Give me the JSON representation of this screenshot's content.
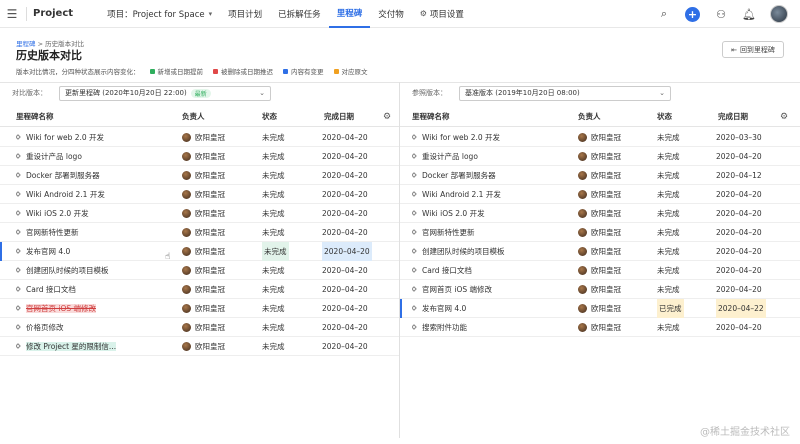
{
  "topbar": {
    "app_title": "Project",
    "project_label": "项目：Project for Space",
    "nav": [
      "项目计划",
      "已拆解任务",
      "里程碑",
      "交付物",
      "项目设置"
    ],
    "active_nav": 2
  },
  "header": {
    "breadcrumb_parent": "里程碑",
    "breadcrumb_sep": ">",
    "breadcrumb_current": "历史版本对比",
    "title": "历史版本对比",
    "back_button": "回到里程碑",
    "legend_intro": "版本对比情况，分四种状态展示内容变化：",
    "legend": [
      {
        "label": "新增或日期提前",
        "color": "#2fae5d"
      },
      {
        "label": "被删除或日期推迟",
        "color": "#e04848"
      },
      {
        "label": "内容有变更",
        "color": "#2f6fe6"
      },
      {
        "label": "对应原文",
        "color": "#f0a020"
      }
    ]
  },
  "left": {
    "compare_label": "对比版本：",
    "select_value": "更新里程碑 (2020年10月20日 22:00)",
    "select_tag": "最新",
    "columns": [
      "里程碑名称",
      "负责人",
      "状态",
      "完成日期"
    ],
    "rows": [
      {
        "name": "Wiki for web 2.0 开发",
        "owner": "欧阳皇冠",
        "status": "未完成",
        "date": "2020–04–20",
        "hl": ""
      },
      {
        "name": "重设计产品 logo",
        "owner": "欧阳皇冠",
        "status": "未完成",
        "date": "2020–04–20",
        "hl": ""
      },
      {
        "name": "Docker 部署到服务器",
        "owner": "欧阳皇冠",
        "status": "未完成",
        "date": "2020–04–20",
        "hl": ""
      },
      {
        "name": "Wiki Android 2.1 开发",
        "owner": "欧阳皇冠",
        "status": "未完成",
        "date": "2020–04–20",
        "hl": ""
      },
      {
        "name": "Wiki iOS 2.0 开发",
        "owner": "欧阳皇冠",
        "status": "未完成",
        "date": "2020–04–20",
        "hl": ""
      },
      {
        "name": "官网新特性更新",
        "owner": "欧阳皇冠",
        "status": "未完成",
        "date": "2020–04–20",
        "hl": ""
      },
      {
        "name": "发布官网 4.0",
        "owner": "欧阳皇冠",
        "status": "未完成",
        "date": "2020–04–20",
        "hl": "changed"
      },
      {
        "name": "创建团队时候的项目模板",
        "owner": "欧阳皇冠",
        "status": "未完成",
        "date": "2020–04–20",
        "hl": ""
      },
      {
        "name": "Card 接口文档",
        "owner": "欧阳皇冠",
        "status": "未完成",
        "date": "2020–04–20",
        "hl": ""
      },
      {
        "name": "官网首页 iOS 端修改",
        "owner": "欧阳皇冠",
        "status": "未完成",
        "date": "2020–04–20",
        "hl": "deleted"
      },
      {
        "name": "价格页修改",
        "owner": "欧阳皇冠",
        "status": "未完成",
        "date": "2020–04–20",
        "hl": ""
      },
      {
        "name": "修改 Project 星的限制信...",
        "owner": "欧阳皇冠",
        "status": "未完成",
        "date": "2020–04–20",
        "hl": "added"
      }
    ]
  },
  "right": {
    "compare_label": "参照版本：",
    "select_value": "基准版本 (2019年10月20日 08:00)",
    "columns": [
      "里程碑名称",
      "负责人",
      "状态",
      "完成日期"
    ],
    "rows": [
      {
        "name": "Wiki for web 2.0 开发",
        "owner": "欧阳皇冠",
        "status": "未完成",
        "date": "2020–03–30",
        "hl": ""
      },
      {
        "name": "重设计产品 logo",
        "owner": "欧阳皇冠",
        "status": "未完成",
        "date": "2020–04–20",
        "hl": ""
      },
      {
        "name": "Docker 部署到服务器",
        "owner": "欧阳皇冠",
        "status": "未完成",
        "date": "2020–04–12",
        "hl": ""
      },
      {
        "name": "Wiki Android 2.1 开发",
        "owner": "欧阳皇冠",
        "status": "未完成",
        "date": "2020–04–20",
        "hl": ""
      },
      {
        "name": "Wiki iOS 2.0 开发",
        "owner": "欧阳皇冠",
        "status": "未完成",
        "date": "2020–04–20",
        "hl": ""
      },
      {
        "name": "官网新特性更新",
        "owner": "欧阳皇冠",
        "status": "未完成",
        "date": "2020–04–20",
        "hl": ""
      },
      {
        "name": "创建团队时候的项目模板",
        "owner": "欧阳皇冠",
        "status": "未完成",
        "date": "2020–04–20",
        "hl": ""
      },
      {
        "name": "Card 接口文档",
        "owner": "欧阳皇冠",
        "status": "未完成",
        "date": "2020–04–20",
        "hl": ""
      },
      {
        "name": "官网首页 iOS 端修改",
        "owner": "欧阳皇冠",
        "status": "未完成",
        "date": "2020–04–20",
        "hl": ""
      },
      {
        "name": "发布官网 4.0",
        "owner": "欧阳皇冠",
        "status": "已完成",
        "date": "2020–04–22",
        "hl": "original"
      },
      {
        "name": "搜索附件功能",
        "owner": "欧阳皇冠",
        "status": "未完成",
        "date": "2020–04–20",
        "hl": ""
      }
    ]
  },
  "watermark": "@稀土掘金技术社区"
}
